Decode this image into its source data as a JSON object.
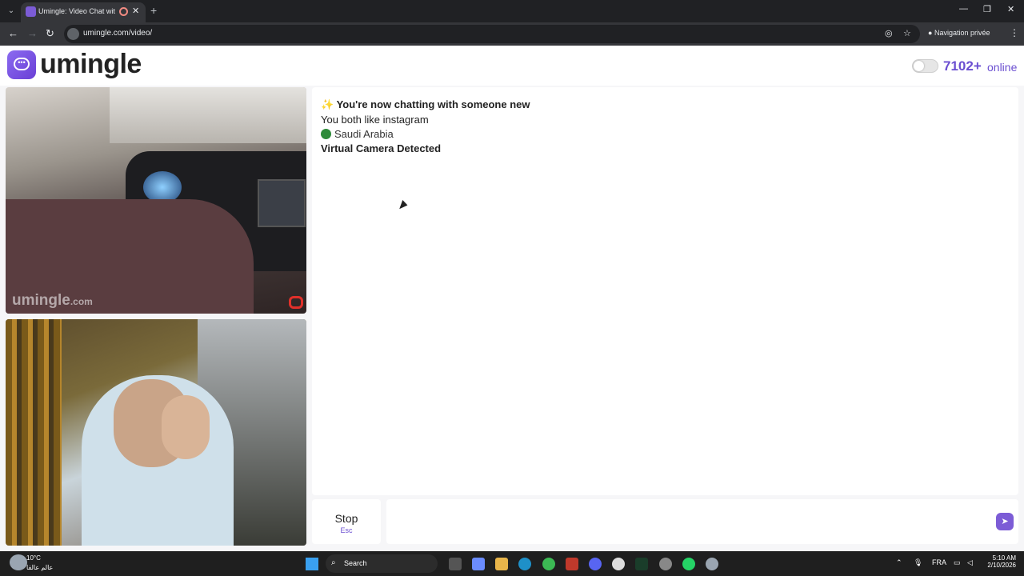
{
  "browser": {
    "tab_title": "Umingle: Video Chat with S",
    "url": "umingle.com/video/",
    "private_label": "Navigation privée"
  },
  "header": {
    "logo_text": "umingle",
    "online_count": "7102+",
    "online_label": "online"
  },
  "video_remote": {
    "watermark": "umingle",
    "watermark_suffix": ".com"
  },
  "chat": {
    "messages": [
      {
        "text": "You're now chatting with someone new",
        "icon": "sparkles-icon"
      },
      {
        "text": "You both like instagram"
      },
      {
        "text": "Saudi Arabia",
        "icon": "flag-icon"
      },
      {
        "text": "Virtual Camera Detected"
      }
    ]
  },
  "controls": {
    "stop_label": "Stop",
    "stop_key": "Esc",
    "message_placeholder": ""
  },
  "taskbar": {
    "temperature": "10°C",
    "location": "عالم عالقا",
    "search_label": "Search",
    "language": "FRA",
    "time": "5:10 AM",
    "date": "2/10/2026"
  },
  "colors": {
    "accent": "#6b4fd1",
    "brand": "#7c5cd6"
  }
}
